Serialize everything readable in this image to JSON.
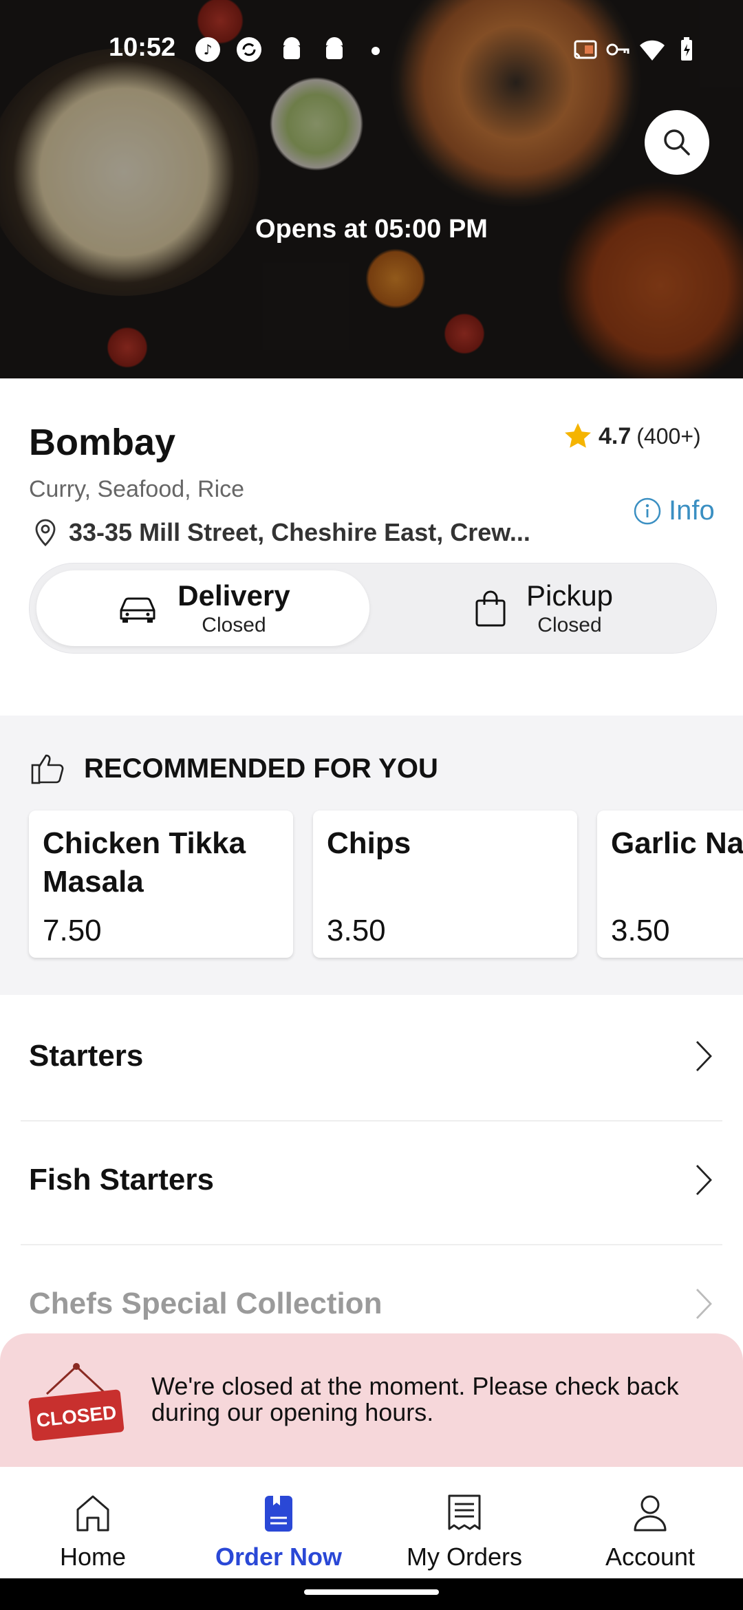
{
  "status_bar": {
    "time": "10:52",
    "icons": [
      "tiktok-icon",
      "sync-icon",
      "android-icon",
      "android-icon",
      "dot-icon",
      "cast-icon",
      "vpn-key-icon",
      "wifi-icon",
      "battery-charging-icon"
    ]
  },
  "hero": {
    "opens_text": "Opens at 05:00 PM",
    "search_icon": "search-icon"
  },
  "restaurant": {
    "name": "Bombay",
    "rating": "4.7",
    "rating_count": "(400+)",
    "cuisines": "Curry, Seafood, Rice",
    "info_label": "Info",
    "address": "33-35 Mill Street, Cheshire East, Crew..."
  },
  "order_modes": {
    "delivery": {
      "label": "Delivery",
      "status": "Closed",
      "selected": true
    },
    "pickup": {
      "label": "Pickup",
      "status": "Closed",
      "selected": false
    }
  },
  "recommended": {
    "title": "RECOMMENDED FOR YOU",
    "items": [
      {
        "name": "Chicken Tikka Masala",
        "price": "7.50"
      },
      {
        "name": "Chips",
        "price": "3.50"
      },
      {
        "name": "Garlic Nan",
        "price": "3.50"
      }
    ]
  },
  "categories": [
    {
      "label": "Starters"
    },
    {
      "label": "Fish Starters"
    },
    {
      "label": "Chefs Special Collection"
    }
  ],
  "closed_banner": {
    "sign_text": "CLOSED",
    "message": "We're closed at the moment. Please check back during our opening hours."
  },
  "bottom_nav": [
    {
      "label": "Home",
      "icon": "home-icon",
      "active": false
    },
    {
      "label": "Order Now",
      "icon": "order-book-icon",
      "active": true
    },
    {
      "label": "My Orders",
      "icon": "receipt-icon",
      "active": false
    },
    {
      "label": "Account",
      "icon": "account-icon",
      "active": false
    }
  ],
  "colors": {
    "accent": "#2a48d6",
    "info_link": "#3a8fc2",
    "star": "#f5b400",
    "closed_banner_bg": "#f6d7da",
    "closed_sign_red": "#c8302e"
  }
}
